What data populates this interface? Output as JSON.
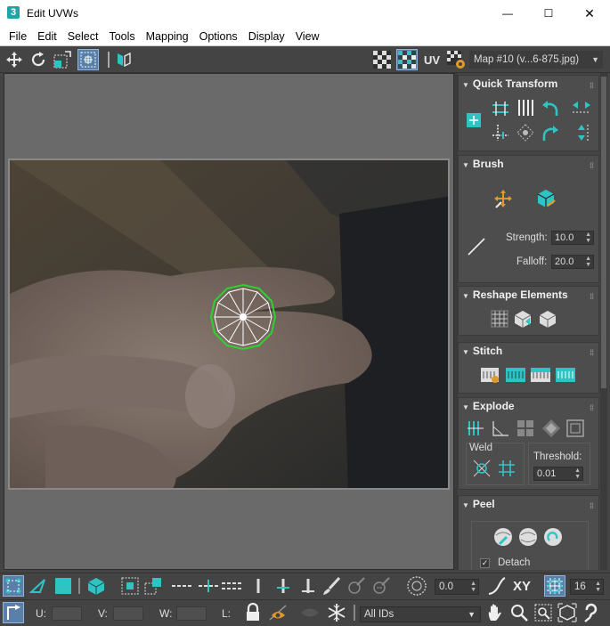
{
  "window": {
    "app_icon_text": "3",
    "title": "Edit UVWs",
    "min_symbol": "—",
    "max_symbol": "☐",
    "close_symbol": "✕"
  },
  "menu": {
    "items": [
      "File",
      "Edit",
      "Select",
      "Tools",
      "Mapping",
      "Options",
      "Display",
      "View"
    ]
  },
  "toolbar": {
    "uv_label": "UV",
    "map_select": "Map #10 (v...6-875.jpg)"
  },
  "panel": {
    "quick_transform": {
      "title": "Quick Transform"
    },
    "brush": {
      "title": "Brush",
      "strength_label": "Strength:",
      "strength_value": "10.0",
      "falloff_label": "Falloff:",
      "falloff_value": "20.0"
    },
    "reshape": {
      "title": "Reshape Elements"
    },
    "stitch": {
      "title": "Stitch"
    },
    "explode": {
      "title": "Explode",
      "weld_label": "Weld",
      "threshold_label": "Threshold:",
      "threshold_value": "0.01"
    },
    "peel": {
      "title": "Peel",
      "detach_label": "Detach",
      "detach_checked": true
    }
  },
  "bottom": {
    "offset_value": "0.0",
    "xy_label": "XY",
    "grid_value": "16",
    "u_label": "U:",
    "v_label": "V:",
    "w_label": "W:",
    "l_label": "L:",
    "ids_select": "All IDs"
  },
  "colors": {
    "accent_teal": "#2ec4c4",
    "ui_bg": "#444444",
    "active_blue": "#5a7fa8",
    "uv_green": "#2ed12e"
  }
}
